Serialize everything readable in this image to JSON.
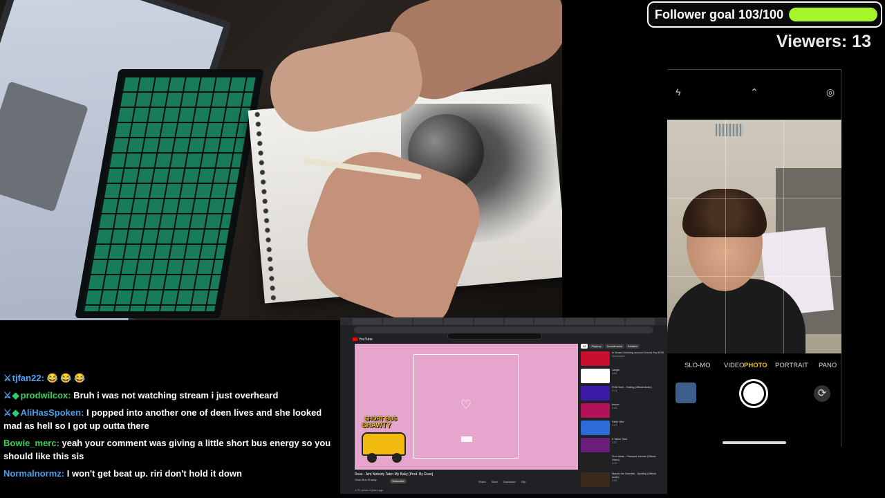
{
  "overlay": {
    "follower_goal_label": "Follower goal 103/100",
    "follower_goal_progress": 1.0,
    "follower_goal_color": "#a6f52a",
    "viewers_label": "Viewers: 13"
  },
  "camera": {
    "modes": [
      "SLO-MO",
      "VIDEO",
      "PHOTO",
      "PORTRAIT",
      "PANO"
    ],
    "active_mode": "PHOTO",
    "icons": [
      "flash-off-icon",
      "chevron-up-icon",
      "live-photo-icon",
      "flip-camera-icon"
    ]
  },
  "chat": {
    "messages": [
      {
        "user": "tjfan22",
        "text": "😂 😂 😂"
      },
      {
        "user": "prodwilcox",
        "text": "Bruh i was not watching stream i just overheard"
      },
      {
        "user": "AliHasSpoken",
        "text": "I popped into another one of deen lives and she looked mad as hell so I got up outta there"
      },
      {
        "user": "Bowie_merc",
        "text": "yeah your comment was giving a little short bus energy so you should like this sis"
      },
      {
        "user": "Normalnormz",
        "text": "I won't get beat up. riri don't hold it down"
      }
    ]
  },
  "browser": {
    "site": "YouTube",
    "video_title": "Ruse - Aint Nobody Takin My Baby [Prod. By Ruse]",
    "channel": "Short Bus Shawty",
    "subscribe_label": "Subscribe",
    "actions": [
      "Share",
      "Save",
      "Download",
      "Clip"
    ],
    "views": "4.7K views  6 years ago",
    "overlay_logo_line1": "SHORT BUS",
    "overlay_logo_line2": "SHAWTY",
    "chips": [
      "All",
      "Playboy",
      "Soundtracks",
      "Related"
    ],
    "recommendations": [
      {
        "title": "Is Smart Checking account Gonna Pay $700",
        "meta": "Sponsored",
        "color": "#c8102e"
      },
      {
        "title": "Jangle",
        "meta": "4:00",
        "color": "#ffffff"
      },
      {
        "title": "Phill Hook - Fading (Official Audio)",
        "meta": "2:11",
        "color": "#3a1aa8"
      },
      {
        "title": "butner",
        "meta": "2:43",
        "color": "#b0135a"
      },
      {
        "title": "Fallin Vibe",
        "meta": "1:27",
        "color": "#2f6bd8"
      },
      {
        "title": "It Takes Time",
        "meta": "2:01",
        "color": "#6a1e7a"
      },
      {
        "title": "Soul Ideas - Passport Jumbie (Official Video)",
        "meta": "3:10",
        "color": "#222222"
      },
      {
        "title": "Mariah the Scientist - Spoiling (Official audio)",
        "meta": "3:03",
        "color": "#3b2a1a"
      }
    ]
  }
}
